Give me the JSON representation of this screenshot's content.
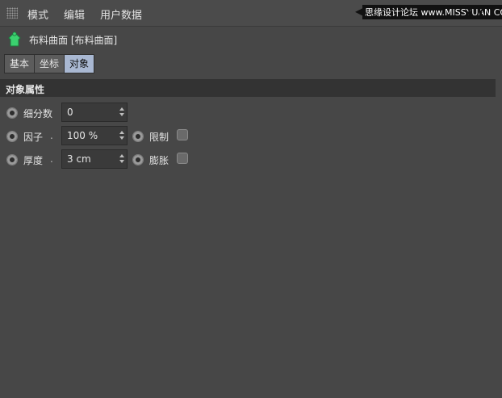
{
  "menubar": {
    "items": [
      "模式",
      "编辑",
      "用户数据"
    ]
  },
  "watermark": {
    "text": "思缘设计论坛 www.MISSYUAN.COM"
  },
  "object": {
    "title": "布料曲面 [布料曲面]",
    "icon": "cloth-surface-icon"
  },
  "tabs": [
    {
      "label": "基本",
      "active": false
    },
    {
      "label": "坐标",
      "active": false
    },
    {
      "label": "对象",
      "active": true
    }
  ],
  "section": {
    "title": "对象属性"
  },
  "params": {
    "subdivisions": {
      "label": "细分数",
      "value": "0"
    },
    "factor": {
      "label": "因子",
      "dot": ".",
      "value": "100 %"
    },
    "limit": {
      "label": "限制",
      "checked": false
    },
    "thickness": {
      "label": "厚度",
      "dot": ".",
      "value": "3 cm"
    },
    "expand": {
      "label": "膨胀",
      "checked": false
    }
  },
  "colors": {
    "background": "#474747",
    "tab_active": "#a9b8d2",
    "section_header": "#333333",
    "icon_green": "#3bd16f"
  }
}
